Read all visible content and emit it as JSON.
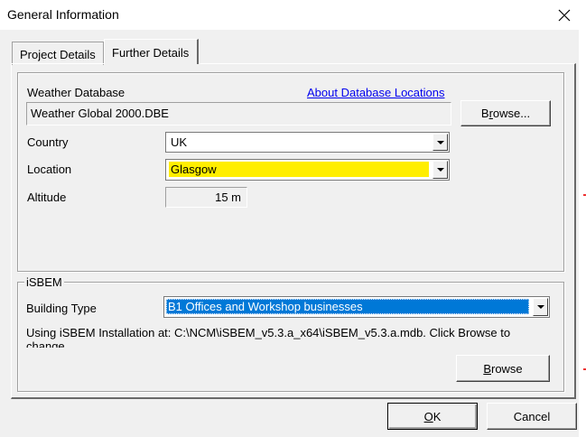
{
  "window": {
    "title": "General Information",
    "close_icon": "close-icon"
  },
  "tabs": [
    {
      "label": "Project Details",
      "active": false
    },
    {
      "label": "Further Details",
      "active": true
    }
  ],
  "weather": {
    "database_label": "Weather Database",
    "database_link": "About Database Locations",
    "database_value": "Weather Global 2000.DBE",
    "browse_label_pre": "B",
    "browse_label_ul": "r",
    "browse_label_post": "owse...",
    "country_label": "Country",
    "country_value": "UK",
    "location_label": "Location",
    "location_value": "Glasgow",
    "location_highlight": "#ffee00",
    "altitude_label": "Altitude",
    "altitude_value": "15 m"
  },
  "isbem": {
    "group_label": "iSBEM",
    "building_type_label": "Building Type",
    "building_type_value": "B1 Offices and Workshop businesses",
    "selection_color": "#0078d7",
    "installation_text_line1": "Using iSBEM Installation at: C:\\NCM\\iSBEM_v5.3.a_x64\\iSBEM_v5.3.a.mdb. Click Browse to",
    "installation_text_line2": "change",
    "browse_label_ul": "B",
    "browse_label_post": "rowse"
  },
  "footer": {
    "ok_label_ul": "O",
    "ok_label_post": "K",
    "cancel_label": "Cancel"
  }
}
